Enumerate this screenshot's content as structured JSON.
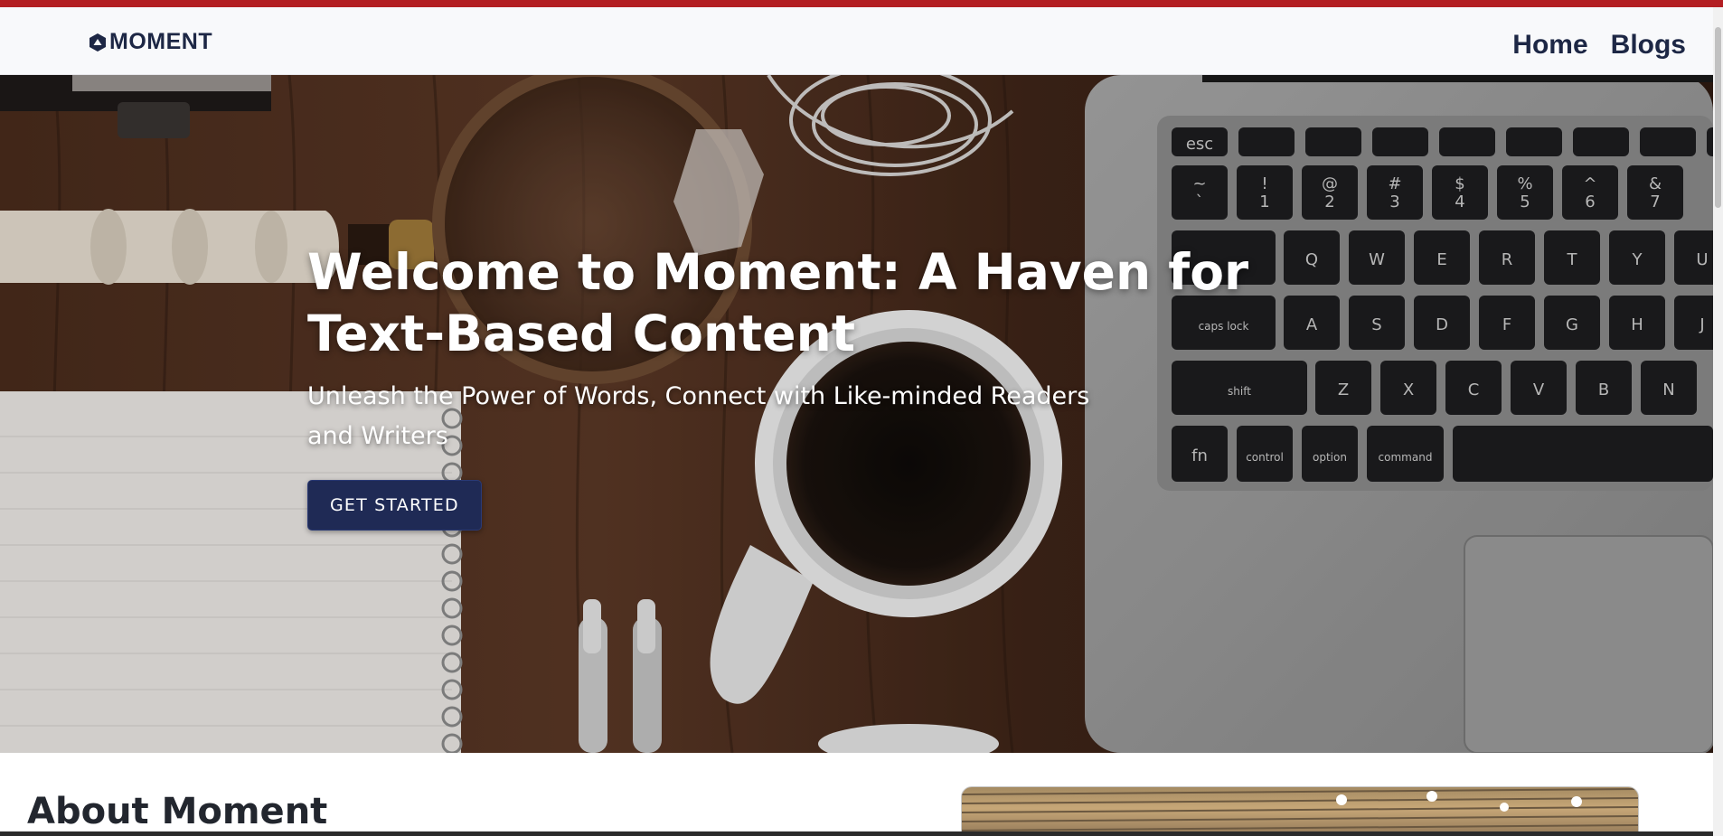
{
  "brand": {
    "name": "MOMENT",
    "icon": "moment-logo-icon",
    "accent_color": "#b31e22",
    "nav_color": "#1d2745"
  },
  "nav": {
    "items": [
      {
        "label": "Home"
      },
      {
        "label": "Blogs"
      }
    ]
  },
  "hero": {
    "title": "Welcome to Moment: A Haven for Text-Based Content",
    "subtitle": "Unleash the Power of Words, Connect with Like-minded Readers and Writers",
    "cta_label": "GET STARTED",
    "cta_color": "#1f2a55",
    "background_icon": "desk-with-coffee-laptop-notebook-image"
  },
  "about": {
    "title": "About Moment",
    "image_icon": "office-interior-image"
  },
  "keyboard": {
    "row0": [
      "esc",
      "",
      "",
      "",
      "",
      "",
      "",
      "",
      ""
    ],
    "row1": [
      "~\n`",
      "!\n1",
      "@\n2",
      "#\n3",
      "$\n4",
      "%\n5",
      "^\n6",
      "&\n7"
    ],
    "row2": [
      "Q",
      "W",
      "E",
      "R",
      "T",
      "Y",
      "U"
    ],
    "row3": [
      "A",
      "S",
      "D",
      "F",
      "G",
      "H",
      "J"
    ],
    "row4": [
      "Z",
      "X",
      "C",
      "V",
      "B",
      "N"
    ],
    "row5": [
      "fn",
      "control",
      "option",
      "command"
    ],
    "caps": "caps lock",
    "shift": "shift"
  }
}
